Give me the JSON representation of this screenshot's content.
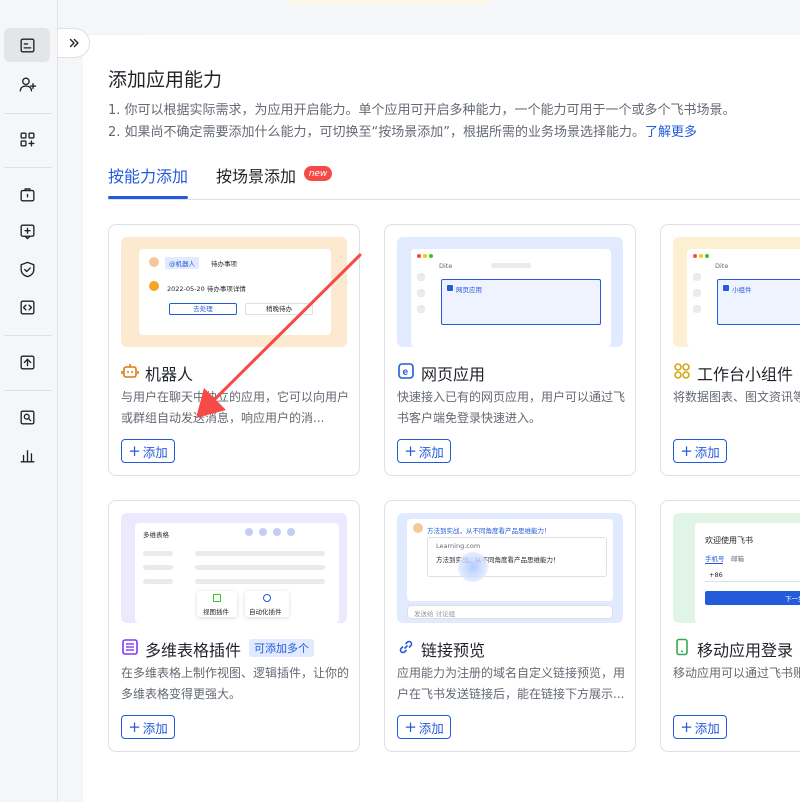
{
  "sidebar": {
    "items": [
      {
        "name": "sidebar-basic-info",
        "icon": "doc-list-icon",
        "active": true
      },
      {
        "name": "sidebar-members",
        "icon": "user-add-icon"
      },
      {
        "name": "sidebar-app-capabilities",
        "icon": "apps-add-icon"
      },
      {
        "name": "sidebar-permissions",
        "icon": "briefcase-lock-icon"
      },
      {
        "name": "sidebar-events",
        "icon": "box-add-icon"
      },
      {
        "name": "sidebar-security",
        "icon": "shield-check-icon"
      },
      {
        "name": "sidebar-development",
        "icon": "code-icon"
      },
      {
        "name": "sidebar-release",
        "icon": "upload-icon"
      },
      {
        "name": "sidebar-logs",
        "icon": "search-doc-icon"
      },
      {
        "name": "sidebar-analytics",
        "icon": "bar-chart-icon"
      }
    ]
  },
  "page": {
    "title": "添加应用能力",
    "desc1": "1. 你可以根据实际需求，为应用开启能力。单个应用可开启多种能力，一个能力可用于一个或多个飞书场景。",
    "desc2": "2. 如果尚不确定需要添加什么能力，可切换至“按场景添加”，根据所需的业务场景选择能力。",
    "learn_more": "了解更多"
  },
  "tabs": {
    "by_capability": "按能力添加",
    "by_scene": "按场景添加",
    "new_badge": "new"
  },
  "cards": [
    {
      "title": "机器人",
      "desc": "与用户在聊天中独立的应用，它可以向用户或群组自动发送消息，响应用户的消...",
      "add": "添加",
      "color": "#fde8d0"
    },
    {
      "title": "网页应用",
      "desc": "快速接入已有的网页应用，用户可以通过飞书客户端免登录快速进入。",
      "add": "添加",
      "color": "#e1eaff"
    },
    {
      "title": "工作台小组件",
      "desc": "将数据图表、图文资讯等添加到工作台。",
      "add": "添加",
      "color": "#fdf0d2"
    },
    {
      "title": "多维表格插件",
      "badge": "可添加多个",
      "desc": "在多维表格上制作视图、逻辑插件，让你的多维表格变得更强大。",
      "add": "添加",
      "color": "#ece8fd"
    },
    {
      "title": "链接预览",
      "desc": "应用能力为注册的域名自定义链接预览，用户在飞书发送链接后，能在链接下方展示...",
      "add": "添加",
      "color": "#e1eaff"
    },
    {
      "title": "移动应用登录",
      "desc": "移动应用可以通过飞书账",
      "add": "添加",
      "color": "#e0f5e6"
    }
  ],
  "previews": {
    "bot_tag": "@机器人",
    "bot_task": "待办事项",
    "bot_date": "2022-05-20 待办事项详情",
    "bot_btn1": "去处理",
    "bot_btn2": "稍晚待办",
    "web_tab": "Dite",
    "web_panel": "网页应用",
    "widget_tab": "Dite",
    "widget_panel": "小组件",
    "base_title": "多维表格",
    "base_view": "视图插件",
    "base_auto": "自动化插件",
    "link_msg": "方法到实战，从不同角度看产品思维能力！",
    "link_domain": "Learning.com",
    "link_body": "方法到实战，从不同角度看产品思维能力！",
    "link_input": "发送给 讨论组",
    "login_title": "欢迎使用飞书",
    "login_tab1": "手机号",
    "login_tab2": "邮箱",
    "login_code": "+86",
    "login_next": "下一步"
  },
  "colors": {
    "accent": "#245bdb",
    "arrow": "#f54a45",
    "badge_new": "#f54a45"
  }
}
